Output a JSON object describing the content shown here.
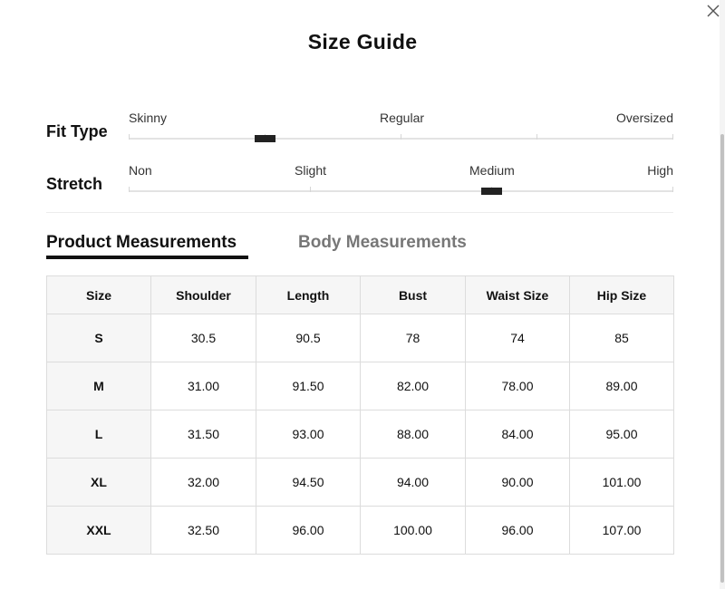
{
  "dialog": {
    "title": "Size Guide",
    "close_icon": "close-icon"
  },
  "fit_type": {
    "label": "Fit Type",
    "options": [
      "Skinny",
      "Regular",
      "Oversized"
    ],
    "selected_position": 0.25
  },
  "stretch": {
    "label": "Stretch",
    "options": [
      "Non",
      "Slight",
      "Medium",
      "High"
    ],
    "selected_position": 0.667
  },
  "tabs": [
    {
      "label": "Product Measurements",
      "active": true
    },
    {
      "label": "Body Measurements",
      "active": false
    }
  ],
  "table": {
    "headers": [
      "Size",
      "Shoulder",
      "Length",
      "Bust",
      "Waist Size",
      "Hip Size"
    ],
    "rows": [
      [
        "S",
        "30.5",
        "90.5",
        "78",
        "74",
        "85"
      ],
      [
        "M",
        "31.00",
        "91.50",
        "82.00",
        "78.00",
        "89.00"
      ],
      [
        "L",
        "31.50",
        "93.00",
        "88.00",
        "84.00",
        "95.00"
      ],
      [
        "XL",
        "32.00",
        "94.50",
        "94.00",
        "90.00",
        "101.00"
      ],
      [
        "XXL",
        "32.50",
        "96.00",
        "100.00",
        "96.00",
        "107.00"
      ]
    ]
  }
}
